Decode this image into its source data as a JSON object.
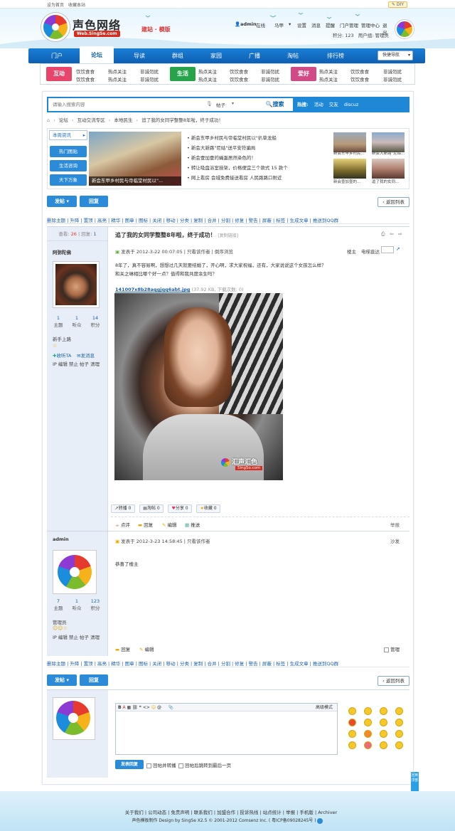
{
  "topbar": {
    "set_home": "设为首页",
    "favorite": "收藏本站",
    "diy": "✎ DIY"
  },
  "site": {
    "name": "声色网络",
    "url": "Web.SingSe.com",
    "slogan": "建站 · 模版"
  },
  "user": {
    "name": "admin",
    "status": "在线",
    "horse": "马甲",
    "links": [
      "设置",
      "消息",
      "提醒",
      "门户管理",
      "管理中心",
      "退出"
    ],
    "points": "积分: 123",
    "group": "用户组: 管理员"
  },
  "nav": {
    "items": [
      "门户",
      "论坛",
      "导读",
      "群组",
      "家园",
      "广播",
      "淘帖",
      "排行榜"
    ],
    "active": "论坛",
    "quick": "快捷导航"
  },
  "subnav": {
    "tags": [
      "互动",
      "生活",
      "爱好"
    ],
    "links": [
      "饮饮食食",
      "热点关注",
      "非诚勿扰"
    ]
  },
  "search": {
    "placeholder": "请输入搜索内容",
    "type": "帖子",
    "button": "搜索",
    "hot_label": "热搜:",
    "hot": [
      "活动",
      "交友",
      "discuz"
    ]
  },
  "breadcrumb": [
    "论坛",
    "互动交流专区",
    "本地民生",
    "追了我的女同学整整8年啦，终于成功！"
  ],
  "news": {
    "tabs": [
      "本周资讯",
      "热门图贴",
      "生活咨询",
      "天下万象"
    ],
    "photo_caption": "新会东甲乡村民与帝临堂村民以\"...",
    "lines": [
      "新会东甲乡村民与帝临堂村民以\"扒草龙船",
      "新会大新路\"尼姑\"送平安符骗局",
      "新会壹加壹的蝇蛋居然染色的！",
      "转让吸盘浴室挂架，价格便宜三个款式 15 款个",
      "网上看房 会城免费接送看房 人民路路口附近"
    ],
    "thumbs": [
      "新会东甲乡村民...",
      "新会大新路\"尼姑...",
      "新会壹加壹的...",
      "逗了我的女同..."
    ]
  },
  "actions": {
    "post": "发帖",
    "reply": "回复",
    "return": "返回列表"
  },
  "mod_tools": [
    "删除主题",
    "升降",
    "置顶",
    "高亮",
    "精华",
    "图章",
    "图标",
    "关闭",
    "移动",
    "分类",
    "复制",
    "合并",
    "分割",
    "修复",
    "警告",
    "屏蔽",
    "标签",
    "生成文章",
    "推送到QQ群"
  ],
  "thread": {
    "views_label": "查看:",
    "views": "26",
    "replies_label": "回复:",
    "replies": "1",
    "title": "追了我的女同学整整8年啦，终于成功！",
    "copy_link": "[复制链接]"
  },
  "post1": {
    "author": "阿弥陀佛",
    "stats": [
      {
        "value": "1",
        "label": "主题"
      },
      {
        "value": "1",
        "label": "听众"
      },
      {
        "value": "14",
        "label": "积分"
      }
    ],
    "rank": "新手上路",
    "follow": "收听TA",
    "message": "发消息",
    "admin_links": "IP 编辑 禁止 帖子 清理",
    "date": "发表于 2012-3-22 00:07:05",
    "only_author": "只看该作者",
    "reverse": "倒序浏览",
    "floor_label": "楼主",
    "jump_label": "电梯直达",
    "body_line1": "8年了，真不容易啊，想想过几天就要结婚了，开心啊，求大家祝福，还有，大家说说这个女孩怎么样？",
    "body_line2": "和关之琳相比哪个好一点？值得和我共度余生吗？",
    "attachment": "141007x8b28aqgjqq6abt.jpg",
    "attachment_meta": "(37.92 KB, 下载次数: 0)",
    "watermark": "汇声汇色",
    "watermark_url": "SingSo.com",
    "share": [
      "转播 0",
      "淘帖 0",
      "分享 0",
      "收藏 0"
    ],
    "foot": [
      "点评",
      "回复",
      "编辑",
      "推送"
    ],
    "report": "举报"
  },
  "post2": {
    "author": "admin",
    "stats": [
      {
        "value": "7",
        "label": "主题"
      },
      {
        "value": "1",
        "label": "听众"
      },
      {
        "value": "123",
        "label": "积分"
      }
    ],
    "rank": "管理员",
    "admin_links": "IP 编辑 禁止 帖子 清理",
    "date": "发表于 2012-3-23 14:58:45",
    "only_author": "只看该作者",
    "floor_label": "沙发",
    "body": "恭喜了楼主",
    "foot": [
      "回复",
      "编辑"
    ],
    "manage": "管理"
  },
  "reply_box": {
    "toolbar_right": "高级模式",
    "submit": "发表回复",
    "option1": "回帖并转播",
    "option2": "回帖后跳转到最后一页"
  },
  "feedback": "回到顶部",
  "footer": {
    "links": [
      "关于我们",
      "公司动态",
      "免责声明",
      "联系我们",
      "加盟合作",
      "投诉热线",
      "站点统计",
      "举报",
      "手机版",
      "Archiver"
    ],
    "copyright": "声色模板制作 Design by SingSe X2.5 © 2001-2012 Comsenz Inc. ( 粤ICP备09028245号 )"
  }
}
